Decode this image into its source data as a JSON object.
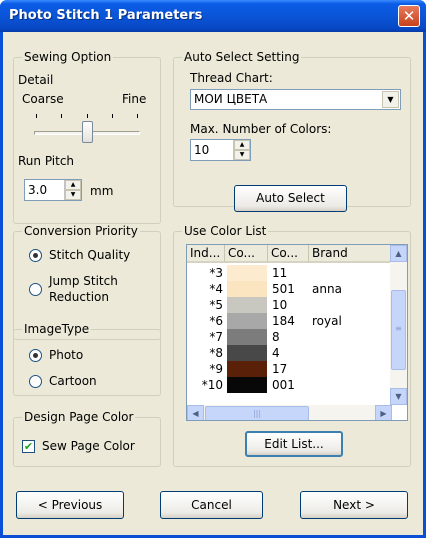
{
  "window": {
    "title": "Photo Stitch 1 Parameters",
    "close_label": "✕"
  },
  "sewing_option": {
    "title": "Sewing Option",
    "detail_label": "Detail",
    "coarse_label": "Coarse",
    "fine_label": "Fine",
    "detail_level": 0.5,
    "run_pitch_label": "Run Pitch",
    "run_pitch_value": "3.0",
    "unit": "mm"
  },
  "auto_select": {
    "title": "Auto Select Setting",
    "thread_chart_label": "Thread Chart:",
    "thread_chart_value": "МОИ ЦВЕТА",
    "max_colors_label": "Max. Number of Colors:",
    "max_colors_value": "10",
    "button_label": "Auto Select"
  },
  "conversion_priority": {
    "title": "Conversion Priority",
    "option1": "Stitch Quality",
    "option2_line1": "Jump Stitch",
    "option2_line2": "Reduction",
    "selected": "Stitch Quality"
  },
  "image_type": {
    "title": "ImageType",
    "option1": "Photo",
    "option2": "Cartoon",
    "selected": "Photo"
  },
  "design_page_color": {
    "title": "Design Page Color",
    "checkbox_label": "Sew Page Color",
    "checked": true
  },
  "use_color_list": {
    "title": "Use Color List",
    "headers": [
      "Ind...",
      "Co...",
      "Co...",
      "Brand"
    ],
    "rows": [
      {
        "index": "*3",
        "color": "#fdebd0",
        "code": "11",
        "brand": ""
      },
      {
        "index": "*4",
        "color": "#fbe5c0",
        "code": "501",
        "brand": "anna"
      },
      {
        "index": "*5",
        "color": "#c8c8c0",
        "code": "10",
        "brand": ""
      },
      {
        "index": "*6",
        "color": "#a8a8a8",
        "code": "184",
        "brand": "royal"
      },
      {
        "index": "*7",
        "color": "#7c7c7c",
        "code": "8",
        "brand": ""
      },
      {
        "index": "*8",
        "color": "#484848",
        "code": "4",
        "brand": ""
      },
      {
        "index": "*9",
        "color": "#5a2008",
        "code": "17",
        "brand": ""
      },
      {
        "index": "*10",
        "color": "#080808",
        "code": "001",
        "brand": ""
      }
    ],
    "edit_button_label": "Edit List..."
  },
  "footer": {
    "previous_label": "< Previous",
    "cancel_label": "Cancel",
    "next_label": "Next >"
  }
}
